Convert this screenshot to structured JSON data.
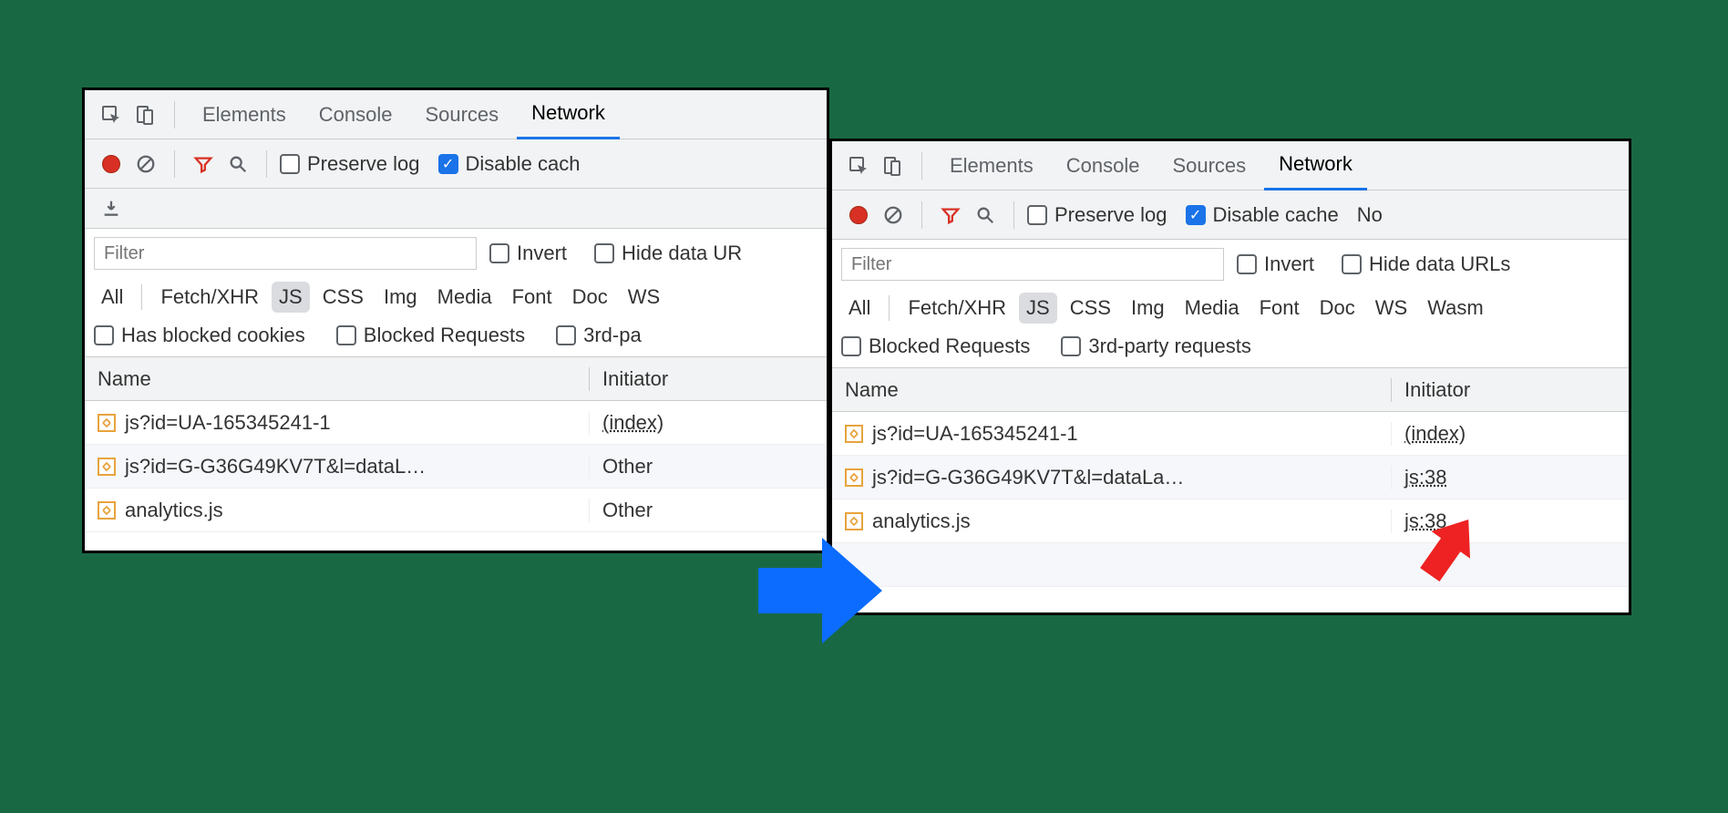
{
  "tabs": {
    "elements": "Elements",
    "console": "Console",
    "sources": "Sources",
    "network": "Network"
  },
  "options": {
    "preserve_log": "Preserve log",
    "disable_cache": "Disable cache",
    "invert": "Invert",
    "hide_data_urls": "Hide data URLs",
    "has_blocked_cookies": "Has blocked cookies",
    "blocked_requests": "Blocked Requests",
    "third_party": "3rd-party requests",
    "no": "No"
  },
  "filter_placeholder": "Filter",
  "types": {
    "all": "All",
    "fetch": "Fetch/XHR",
    "js": "JS",
    "css": "CSS",
    "img": "Img",
    "media": "Media",
    "font": "Font",
    "doc": "Doc",
    "ws": "WS",
    "wasm": "Wasm"
  },
  "columns": {
    "name": "Name",
    "initiator": "Initiator"
  },
  "left": {
    "opts_row": [
      "has_blocked_cookies",
      "blocked_requests"
    ],
    "third_party_truncated": "3rd-pa",
    "disable_cache_truncated": "Disable cach",
    "hide_data_urls_truncated": "Hide data UR",
    "rows": [
      {
        "name": "js?id=UA-165345241-1",
        "initiator": "(index)",
        "initiator_is_link": true
      },
      {
        "name": "js?id=G-G36G49KV7T&l=dataL…",
        "initiator": "Other",
        "initiator_is_link": false
      },
      {
        "name": "analytics.js",
        "initiator": "Other",
        "initiator_is_link": false
      }
    ]
  },
  "right": {
    "rows": [
      {
        "name": "js?id=UA-165345241-1",
        "initiator": "(index)",
        "initiator_is_link": true
      },
      {
        "name": "js?id=G-G36G49KV7T&l=dataLa…",
        "initiator": "js:38",
        "initiator_is_link": true
      },
      {
        "name": "analytics.js",
        "initiator": "js:38",
        "initiator_is_link": true
      }
    ]
  }
}
